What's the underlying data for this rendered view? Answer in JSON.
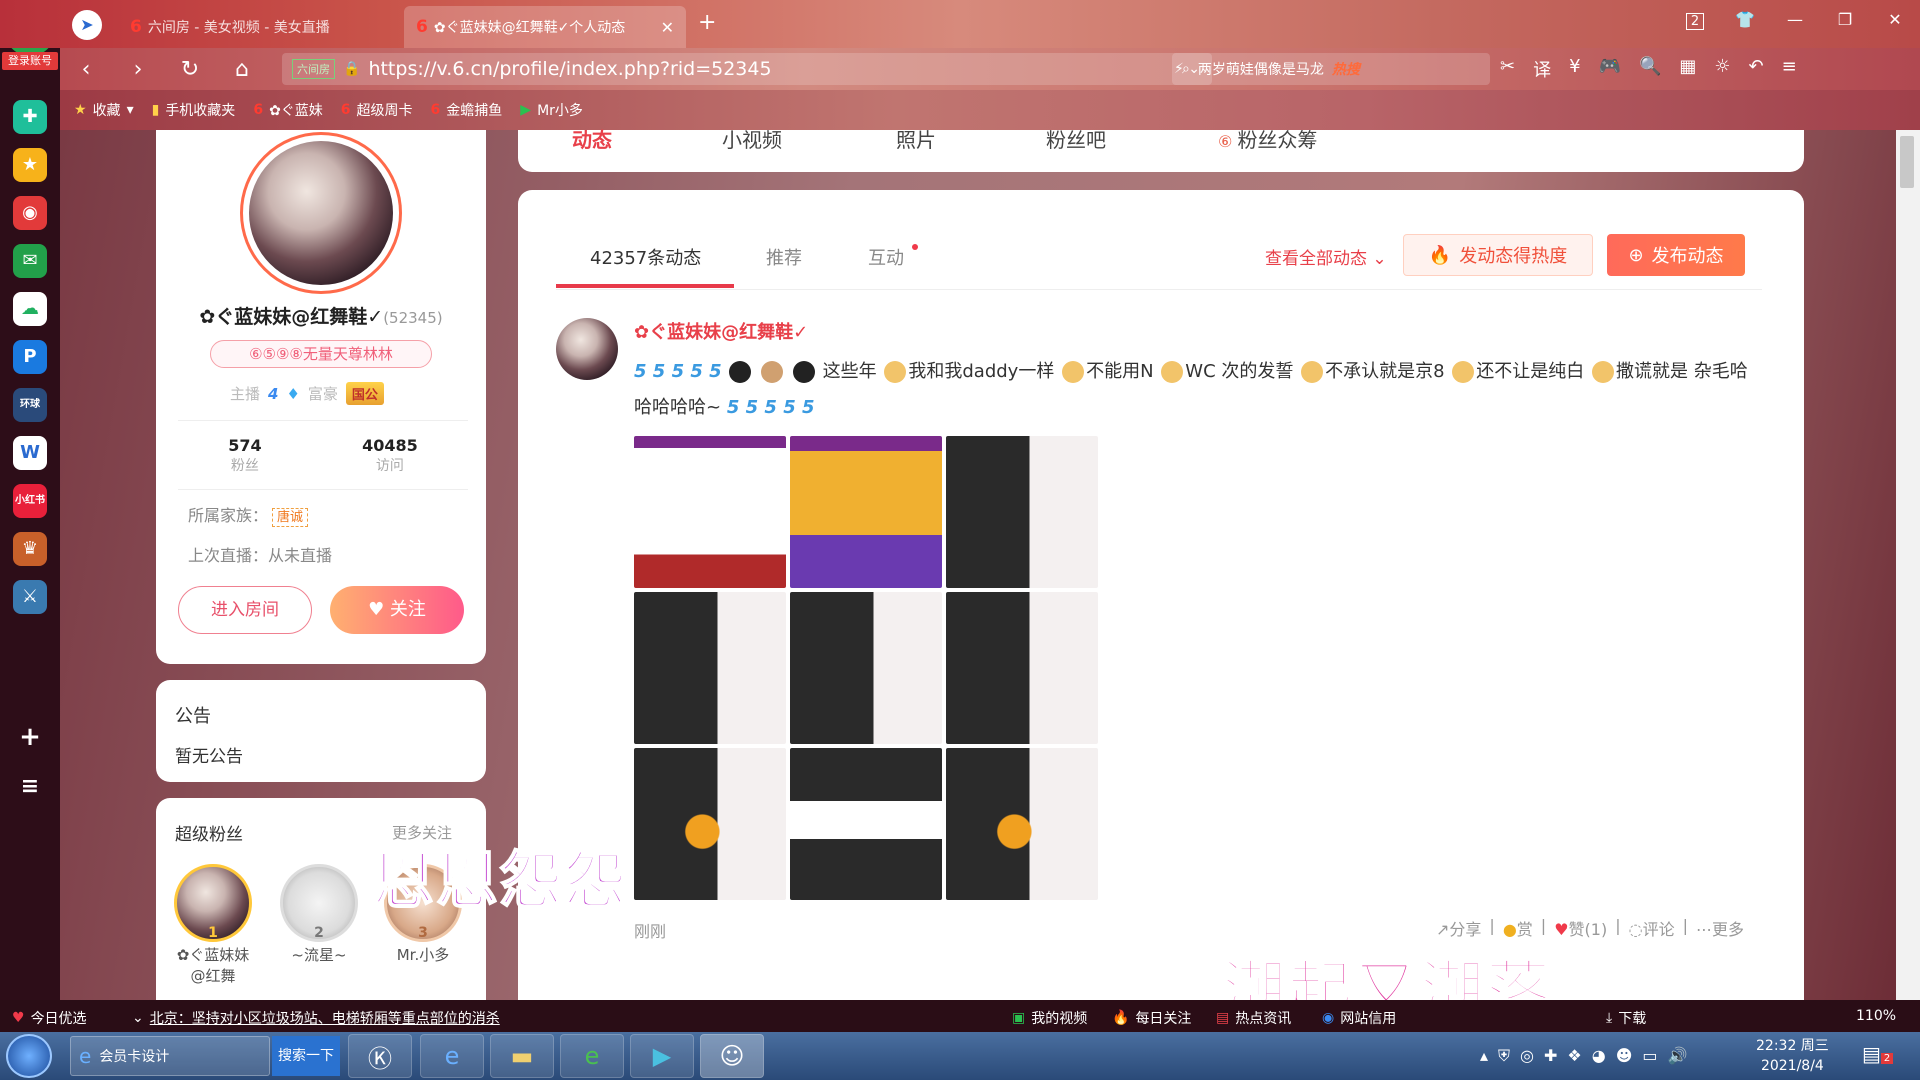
{
  "browser": {
    "tabs": [
      {
        "label": "六间房 - 美女视频 - 美女直播",
        "active": false
      },
      {
        "label": "✿ぐ蓝妹妹@红舞鞋✓个人动态",
        "active": true
      }
    ],
    "tab_count": "2",
    "url_badge": "六间房",
    "url": "https://v.6.cn/profile/index.php?rid=52345",
    "search_text": "两岁萌娃偶像是马龙",
    "search_hot": "热搜",
    "login_label": "登录账号",
    "bookmarks": [
      "收藏",
      "手机收藏夹",
      "✿ぐ蓝妹",
      "超级周卡",
      "金蟾捕鱼",
      "Mr小多"
    ]
  },
  "profile": {
    "name": "✿ぐ蓝妹妹@红舞鞋✓",
    "rid": "(52345)",
    "medal": "⑥⑤⑨⑧无量天尊林林",
    "anchor_label": "主播",
    "anchor_level": "4",
    "rich_label": "富豪",
    "rich_badge": "国公",
    "fans_count": "574",
    "fans_label": "粉丝",
    "visits_count": "40485",
    "visits_label": "访问",
    "family_label": "所属家族：",
    "family_tag": "唐诚",
    "last_live": "上次直播：从未直播",
    "enter_room": "进入房间",
    "follow": "关注"
  },
  "notice": {
    "title": "公告",
    "body": "暂无公告"
  },
  "super_fans": {
    "title": "超级粉丝",
    "more": "更多关注",
    "items": [
      {
        "rank": "1",
        "name": "✿ぐ蓝妹妹@红舞"
      },
      {
        "rank": "2",
        "name": "~流星~"
      },
      {
        "rank": "3",
        "name": "Mr.小多"
      }
    ]
  },
  "top_tabs": [
    "动态",
    "小视频",
    "照片",
    "粉丝吧",
    "粉丝众筹"
  ],
  "feed": {
    "tabs": [
      "42357条动态",
      "推荐",
      "互动"
    ],
    "view_all": "查看全部动态",
    "hot_button": "发动态得热度",
    "post_button": "发布动态",
    "post": {
      "author": "✿ぐ蓝妹妹@红舞鞋✓",
      "text_parts": [
        "这些年",
        "我和我daddy一样",
        "不能用N",
        "WC 次的发誓",
        "不承认就是京8",
        "还不让是纯白",
        "撒谎就是 杂毛哈哈哈哈哈~"
      ],
      "time": "刚刚",
      "actions": [
        "分享",
        "赏",
        "赞(1)",
        "评论",
        "更多"
      ]
    }
  },
  "overlays": [
    "恩恩怨怨",
    "潮起又潮落"
  ],
  "statusbar": {
    "today": "今日优选",
    "news": "北京：坚持对小区垃圾场站、电梯轿厢等重点部位的消杀",
    "items": [
      "我的视频",
      "每日关注",
      "热点资讯",
      "网站信用",
      "下载"
    ],
    "zoom": "110%"
  },
  "taskbar": {
    "ie_title": "会员卡设计",
    "search_btn": "搜索一下",
    "time": "22:32 周三",
    "date": "2021/8/4",
    "notif_count": "2"
  },
  "colors": {
    "accent": "#e8404a",
    "follow_gradient_start": "#ffb070",
    "follow_gradient_end": "#ff5a8a"
  }
}
